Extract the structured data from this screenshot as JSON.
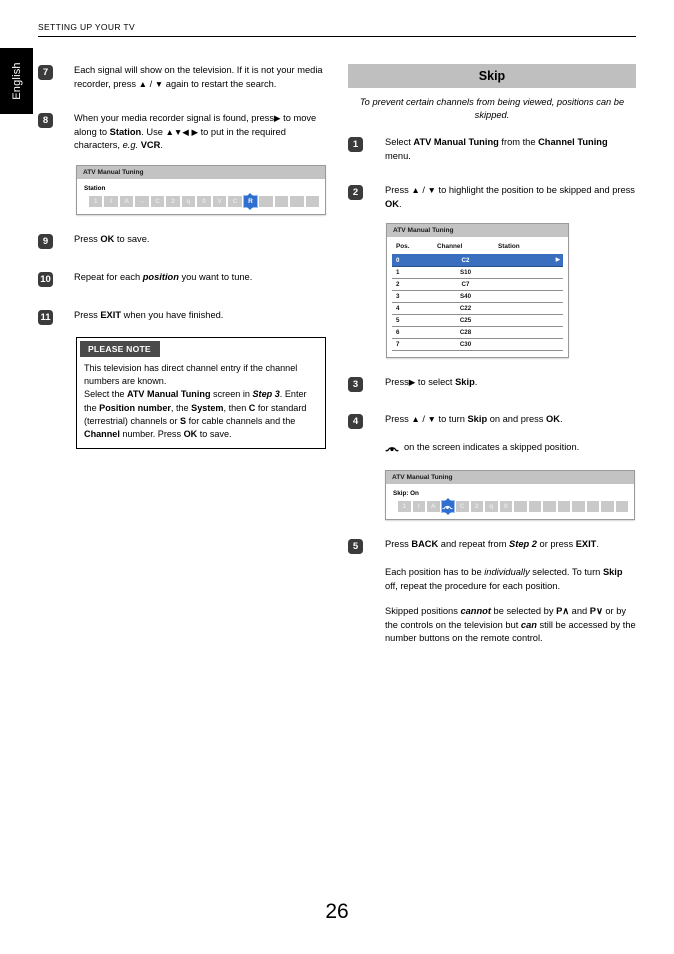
{
  "header": {
    "title": "SETTING UP YOUR TV",
    "language_tab": "English"
  },
  "page_number": "26",
  "colors": {
    "accent_selection": "#2f6fd0",
    "table_selection": "#3a6fbf",
    "section_bar": "#bfbfbf",
    "osd_title_bar": "#c3c3c3",
    "badge": "#3b3b3b",
    "note_head": "#4a4a4a"
  },
  "left_column": {
    "steps": [
      {
        "number": "7",
        "text_html": "Each signal will show on the television. If it is not your media recorder, press <span class=\"ar\">▲</span> / <span class=\"ar\">▼</span> again to restart the search."
      },
      {
        "number": "8",
        "text_html": "When your media recorder signal is found, press<span class=\"ar\">▶</span> to move along to <b>Station</b>. Use <span class=\"ar\">▲▼◀</span> <span class=\"ar\">▶</span> to put in the required characters, <i>e.g.</i> <b>VCR</b>."
      },
      {
        "number": "9",
        "text_html": "Press <b>OK</b> to save."
      },
      {
        "number": "10",
        "text_html": "Repeat for each <span class=\"bi\">position</span> you want to tune."
      },
      {
        "number": "11",
        "text_html": "Press <b>EXIT</b> when you have finished."
      }
    ],
    "osd_station": {
      "title": "ATV Manual Tuning",
      "label": "Station",
      "cells": [
        {
          "glyph": "1",
          "selected": false
        },
        {
          "glyph": "I",
          "selected": false
        },
        {
          "glyph": "A",
          "selected": false
        },
        {
          "glyph": "↔",
          "selected": false
        },
        {
          "glyph": "C",
          "selected": false
        },
        {
          "glyph": "2",
          "selected": false
        },
        {
          "glyph": "q",
          "selected": false
        },
        {
          "glyph": "0",
          "selected": false
        },
        {
          "glyph": "V",
          "selected": false
        },
        {
          "glyph": "C",
          "selected": false
        },
        {
          "glyph": "R",
          "selected": true
        },
        {
          "glyph": "",
          "selected": false
        },
        {
          "glyph": "",
          "selected": false
        },
        {
          "glyph": "",
          "selected": false
        },
        {
          "glyph": "",
          "selected": false
        }
      ]
    },
    "note": {
      "heading": "PLEASE NOTE",
      "body_html": "This television has direct channel entry if the channel numbers are known.<br>Select the <b>ATV Manual Tuning</b> screen in <span class=\"bi\">Step 3</span>. Enter the <b>Position number</b>, the <b>System</b>, then <b>C</b> for standard (terrestrial) channels or <b>S</b> for cable channels and the <b>Channel</b> number. Press <b>OK</b> to save."
    }
  },
  "right_column": {
    "section_title": "Skip",
    "section_subtitle": "To prevent certain channels from being viewed, positions can be skipped.",
    "steps": [
      {
        "number": "1",
        "text_html": "Select <b>ATV Manual Tuning</b> from the <b>Channel Tuning</b> menu."
      },
      {
        "number": "2",
        "text_html": "Press <span class=\"ar\">▲</span> / <span class=\"ar\">▼</span> to highlight the position to be skipped and press <b>OK</b>."
      },
      {
        "number": "3",
        "text_html": "Press<span class=\"ar\">▶</span> to select <b>Skip</b>."
      },
      {
        "number": "4",
        "text_html": "Press <span class=\"ar\">▲</span> / <span class=\"ar\">▼</span> to turn <b>Skip</b> on and press <b>OK</b>."
      },
      {
        "number": "5",
        "text_html": "Press <b>BACK</b> and repeat from <span class=\"bi\">Step 2</span> or press <b>EXIT</b>."
      }
    ],
    "skip_indicator_note": "on the screen indicates a skipped position.",
    "after_step5_paragraphs": [
      "Each position has to be <i>individually</i> selected. To turn <b>Skip</b> off, repeat the procedure for each position.",
      "Skipped positions <span class=\"bi\">cannot</span> be selected by <b>P∧</b> and <b>P∨</b> or by the controls on the television but <span class=\"bi\">can</span> still be accessed by the number buttons on the remote control."
    ],
    "osd_table": {
      "title": "ATV Manual Tuning",
      "columns": [
        "Pos.",
        "Channel",
        "Station"
      ],
      "rows": [
        {
          "pos": "0",
          "channel": "C2",
          "station": "",
          "selected": true
        },
        {
          "pos": "1",
          "channel": "S10",
          "station": "",
          "selected": false
        },
        {
          "pos": "2",
          "channel": "C7",
          "station": "",
          "selected": false
        },
        {
          "pos": "3",
          "channel": "S40",
          "station": "",
          "selected": false
        },
        {
          "pos": "4",
          "channel": "C22",
          "station": "",
          "selected": false
        },
        {
          "pos": "5",
          "channel": "C25",
          "station": "",
          "selected": false
        },
        {
          "pos": "6",
          "channel": "C28",
          "station": "",
          "selected": false
        },
        {
          "pos": "7",
          "channel": "C30",
          "station": "",
          "selected": false
        }
      ]
    },
    "osd_skip": {
      "title": "ATV Manual Tuning",
      "label": "Skip: On",
      "cells": [
        {
          "glyph": "1",
          "selected": false
        },
        {
          "glyph": "I",
          "selected": false
        },
        {
          "glyph": "A",
          "selected": false
        },
        {
          "glyph": "skip-icon",
          "selected": true
        },
        {
          "glyph": "C",
          "selected": false
        },
        {
          "glyph": "2",
          "selected": false
        },
        {
          "glyph": "q",
          "selected": false
        },
        {
          "glyph": "0",
          "selected": false
        },
        {
          "glyph": "",
          "selected": false
        },
        {
          "glyph": "",
          "selected": false
        },
        {
          "glyph": "",
          "selected": false
        },
        {
          "glyph": "",
          "selected": false
        },
        {
          "glyph": "",
          "selected": false
        },
        {
          "glyph": "",
          "selected": false
        },
        {
          "glyph": "",
          "selected": false
        },
        {
          "glyph": "",
          "selected": false
        }
      ]
    }
  }
}
